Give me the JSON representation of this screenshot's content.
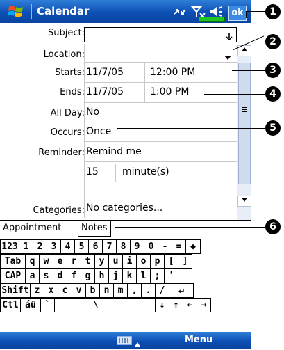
{
  "title_bar": {
    "title": "Calendar",
    "ok_label": "ok"
  },
  "form": {
    "subject_label": "Subject:",
    "location_label": "Location:",
    "starts_label": "Starts:",
    "starts_date": "11/7/05",
    "starts_time": "12:00 PM",
    "ends_label": "Ends:",
    "ends_date": "11/7/05",
    "ends_time": "1:00 PM",
    "allday_label": "All Day:",
    "allday_value": "No",
    "occurs_label": "Occurs:",
    "occurs_value": "Once",
    "reminder_label": "Reminder:",
    "reminder_value": "Remind me",
    "reminder_amount": "15",
    "reminder_unit": "minute(s)",
    "categories_label": "Categories:",
    "categories_value": "No categories..."
  },
  "tabs": [
    {
      "label": "Appointment"
    },
    {
      "label": "Notes"
    }
  ],
  "keyboard": {
    "rows": [
      [
        "123",
        "1",
        "2",
        "3",
        "4",
        "5",
        "6",
        "7",
        "8",
        "9",
        "0",
        "-",
        "=",
        "◆"
      ],
      [
        "Tab",
        "q",
        "w",
        "e",
        "r",
        "t",
        "y",
        "u",
        "i",
        "o",
        "p",
        "[",
        "]"
      ],
      [
        "CAP",
        "a",
        "s",
        "d",
        "f",
        "g",
        "h",
        "j",
        "k",
        "l",
        ";",
        "'"
      ],
      [
        "Shift",
        "z",
        "x",
        "c",
        "v",
        "b",
        "n",
        "m",
        ",",
        ".",
        "/",
        "↵"
      ],
      [
        "Ctl",
        "áü",
        "`",
        "\\",
        "",
        "↓",
        "↑",
        "←",
        "→"
      ]
    ]
  },
  "bottom_bar": {
    "menu_label": "Menu"
  },
  "callouts": [
    "1",
    "2",
    "3",
    "4",
    "5",
    "6"
  ],
  "colors": {
    "bar_blue": "#0d4fb5",
    "battery_green": "#21c521"
  }
}
